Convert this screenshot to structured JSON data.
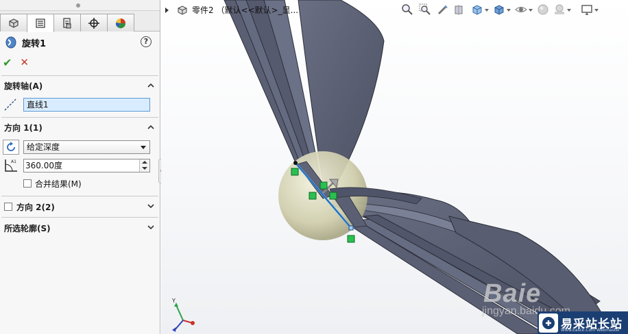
{
  "window": {
    "part_name": "零件2 （默认<<默认>_显..."
  },
  "tabs": [
    {
      "icon": "feature-manager-icon",
      "active": false
    },
    {
      "icon": "property-manager-icon",
      "active": true
    },
    {
      "icon": "configuration-manager-icon",
      "active": false
    },
    {
      "icon": "dimxpert-icon",
      "active": false
    },
    {
      "icon": "display-manager-icon",
      "active": false
    }
  ],
  "feature": {
    "title": "旋转1",
    "help": "?",
    "ok_symbol": "✔",
    "cancel_symbol": "✕"
  },
  "groups": {
    "axis": {
      "title": "旋转轴(A)",
      "value": "直线1"
    },
    "direction1": {
      "title": "方向 1(1)",
      "end_condition": "给定深度",
      "angle": "360.00度",
      "merge_label": "合并结果(M)",
      "merge_checked": false
    },
    "direction2": {
      "title": "方向 2(2)",
      "checked": false
    },
    "contours": {
      "title": "所选轮廓(S)"
    }
  },
  "viewport": {
    "watermark": "Baie",
    "watermark_sub": "jingyan.baidu.com",
    "triad_y_label": "Y",
    "headsup_icons": [
      "zoom-to-fit-icon",
      "zoom-area-icon",
      "previous-view-icon",
      "section-view-icon",
      "view-orientation-icon",
      "display-style-icon",
      "hide-show-icon",
      "edit-appearance-icon",
      "apply-scene-icon",
      "view-settings-icon"
    ]
  },
  "badge": {
    "site_name": "易采站长站",
    "site_url": "Www.Easck.Com Webmaster"
  },
  "colors": {
    "selection_blue": "#5b9ad7",
    "ok_green": "#2e9a2e",
    "cancel_red": "#c23a2b",
    "blade_gray": "#5a5f73",
    "sphere": "#d8d7b9"
  }
}
